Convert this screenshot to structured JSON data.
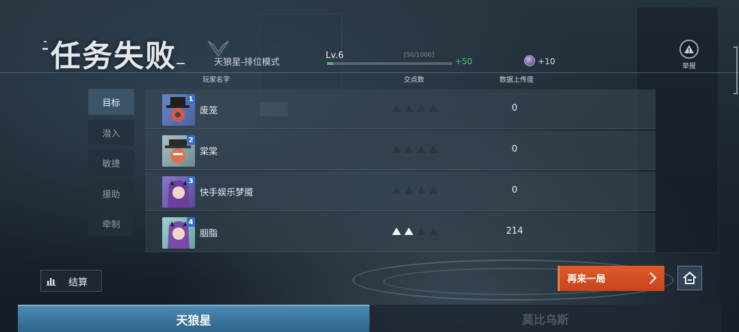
{
  "header": {
    "title": "任务失败",
    "mode": "天狼星-排位模式",
    "level": "Lv.6",
    "xp_text": "[50/1000]",
    "xp_progress": 0.05,
    "xp_gain": "+50",
    "coin_gain": "+10",
    "report_label": "举报"
  },
  "table": {
    "headers": {
      "name": "玩家名字",
      "nodes": "交点数",
      "upload": "数据上传度"
    },
    "rows": [
      {
        "rank": "1",
        "name": "废笼",
        "nodes_filled": 0,
        "nodes_total": 4,
        "upload": "0"
      },
      {
        "rank": "2",
        "name": "棠棠",
        "nodes_filled": 0,
        "nodes_total": 4,
        "upload": "0"
      },
      {
        "rank": "3",
        "name": "快手娱乐梦魇",
        "nodes_filled": 0,
        "nodes_total": 4,
        "upload": "0"
      },
      {
        "rank": "4",
        "name": "胭脂",
        "nodes_filled": 2,
        "nodes_total": 4,
        "upload": "214"
      }
    ]
  },
  "categories": [
    "目标",
    "潜入",
    "敏捷",
    "援助",
    "牵制"
  ],
  "active_category": 0,
  "buttons": {
    "summary": "结算",
    "play_again": "再来一局"
  },
  "teams": {
    "active": "天狼星",
    "inactive": "莫比乌斯"
  },
  "colors": {
    "accent_orange": "#d44f24",
    "xp_green": "#3fbf6a",
    "active_tab": "#3b5468",
    "rank_badge": "#3a6fd0"
  },
  "icons": {
    "mode": "wolf-emblem-icon",
    "coin": "crystal-coin-icon",
    "report": "warning-triangle-icon",
    "summary": "bar-chart-icon",
    "play_again": "chevron-right-icon",
    "home": "home-icon"
  }
}
